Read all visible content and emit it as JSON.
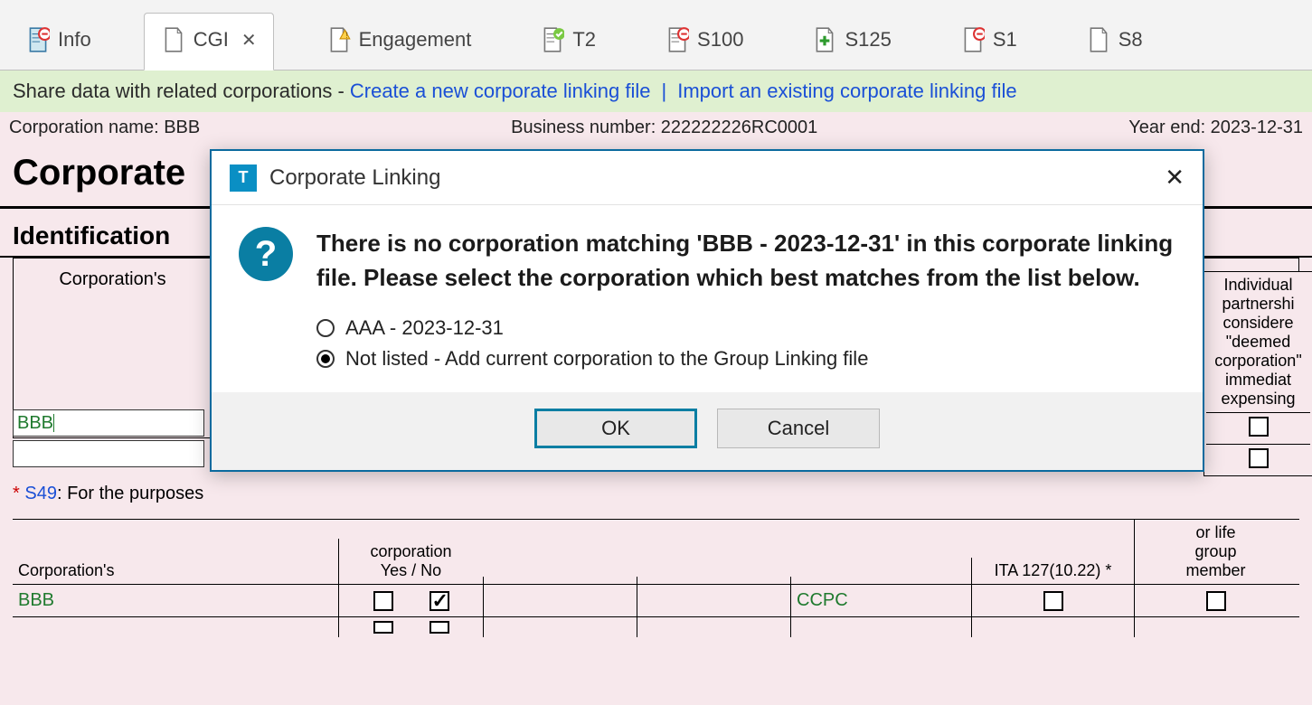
{
  "tabs": [
    {
      "label": "Info",
      "badge": "minus",
      "badgeColor": "#d33"
    },
    {
      "label": "CGI",
      "active": true,
      "closable": true
    },
    {
      "label": "Engagement",
      "badge": "warn"
    },
    {
      "label": "T2",
      "badge": "check",
      "badgeColor": "#4caf50"
    },
    {
      "label": "S100",
      "badge": "minus",
      "badgeColor": "#d33"
    },
    {
      "label": "S125",
      "badge": "plus",
      "badgeColor": "#2e9b2e"
    },
    {
      "label": "S1",
      "badge": "minus",
      "badgeColor": "#d33"
    },
    {
      "label": "S8"
    }
  ],
  "shareBar": {
    "prefix": "Share data with related corporations - ",
    "link1": "Create a new corporate linking file",
    "sep": "|",
    "link2": "Import an existing corporate linking file"
  },
  "infoRow": {
    "corpName": "Corporation name: BBB",
    "busNum": "Business number: 222222226RC0001",
    "yearEnd": "Year end: 2023-12-31"
  },
  "pageHeading": "Corporate",
  "sectionHeading": "Identification",
  "ident": {
    "colHeader": "Corporation's",
    "nameValue": "BBB",
    "note_asterisk": "*",
    "note_link": "S49",
    "note_rest": ": For the purposes"
  },
  "rightCol": {
    "text": "Individual\npartnershi\nconsidere\n\"deemed\ncorporation\"\nimmediat\nexpensing"
  },
  "table2": {
    "headers": {
      "name": "Corporation's",
      "fishing": "corporation\nYes / No",
      "code1": "",
      "code2": "",
      "empty": "",
      "corpType": "",
      "ita": "ITA 127(10.22) *",
      "group": "or life\ngroup\nmember"
    },
    "row": {
      "name": "BBB",
      "fish_no": false,
      "fish_yes": true,
      "type": "CCPC",
      "ita_chk": false,
      "group_chk": false
    }
  },
  "dialog": {
    "title": "Corporate Linking",
    "message": "There is no corporation matching 'BBB - 2023-12-31' in this corporate linking file. Please select the corporation which best matches from the list below.",
    "options": [
      {
        "label": "AAA - 2023-12-31",
        "selected": false
      },
      {
        "label": "Not listed - Add current corporation to the Group Linking file",
        "selected": true
      }
    ],
    "ok": "OK",
    "cancel": "Cancel",
    "closeGlyph": "✕"
  }
}
